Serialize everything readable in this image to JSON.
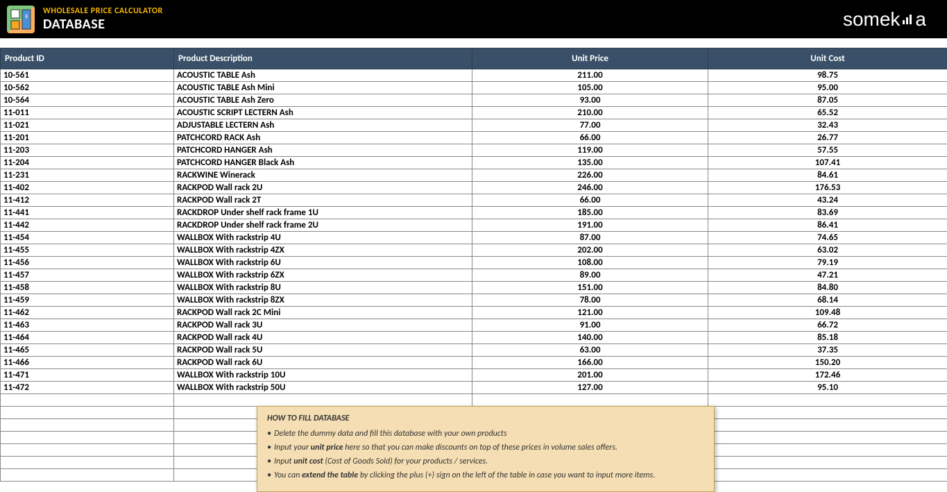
{
  "header": {
    "title1": "WHOLESALE PRICE CALCULATOR",
    "title2": "DATABASE",
    "brand": "someka"
  },
  "columns": {
    "product_id": "Product ID",
    "product_description": "Product Description",
    "unit_price": "Unit Price",
    "unit_cost": "Unit Cost"
  },
  "rows": [
    {
      "id": "10-561",
      "desc": "ACOUSTIC TABLE Ash",
      "price": "211.00",
      "cost": "98.75"
    },
    {
      "id": "10-562",
      "desc": "ACOUSTIC TABLE Ash Mini",
      "price": "105.00",
      "cost": "95.00"
    },
    {
      "id": "10-564",
      "desc": "ACOUSTIC TABLE Ash Zero",
      "price": "93.00",
      "cost": "87.05"
    },
    {
      "id": "11-011",
      "desc": "ACOUSTIC SCRIPT LECTERN Ash",
      "price": "210.00",
      "cost": "65.52"
    },
    {
      "id": "11-021",
      "desc": "ADJUSTABLE LECTERN Ash",
      "price": "77.00",
      "cost": "32.43"
    },
    {
      "id": "11-201",
      "desc": "PATCHCORD RACK Ash",
      "price": "66.00",
      "cost": "26.77"
    },
    {
      "id": "11-203",
      "desc": "PATCHCORD HANGER Ash",
      "price": "119.00",
      "cost": "57.55"
    },
    {
      "id": "11-204",
      "desc": "PATCHCORD HANGER Black Ash",
      "price": "135.00",
      "cost": "107.41"
    },
    {
      "id": "11-231",
      "desc": "RACKWINE Winerack",
      "price": "226.00",
      "cost": "84.61"
    },
    {
      "id": "11-402",
      "desc": "RACKPOD Wall rack 2U",
      "price": "246.00",
      "cost": "176.53"
    },
    {
      "id": "11-412",
      "desc": "RACKPOD Wall rack 2T",
      "price": "66.00",
      "cost": "43.24"
    },
    {
      "id": "11-441",
      "desc": "RACKDROP Under shelf rack frame 1U",
      "price": "185.00",
      "cost": "83.69"
    },
    {
      "id": "11-442",
      "desc": "RACKDROP Under shelf rack frame 2U",
      "price": "191.00",
      "cost": "86.41"
    },
    {
      "id": "11-454",
      "desc": "WALLBOX With rackstrip 4U",
      "price": "87.00",
      "cost": "74.65"
    },
    {
      "id": "11-455",
      "desc": "WALLBOX With rackstrip 4ZX",
      "price": "202.00",
      "cost": "63.02"
    },
    {
      "id": "11-456",
      "desc": "WALLBOX With rackstrip 6U",
      "price": "108.00",
      "cost": "79.19"
    },
    {
      "id": "11-457",
      "desc": "WALLBOX With rackstrip 6ZX",
      "price": "89.00",
      "cost": "47.21"
    },
    {
      "id": "11-458",
      "desc": "WALLBOX With rackstrip 8U",
      "price": "151.00",
      "cost": "84.80"
    },
    {
      "id": "11-459",
      "desc": "WALLBOX With rackstrip 8ZX",
      "price": "78.00",
      "cost": "68.14"
    },
    {
      "id": "11-462",
      "desc": "RACKPOD Wall rack 2C Mini",
      "price": "121.00",
      "cost": "109.48"
    },
    {
      "id": "11-463",
      "desc": "RACKPOD Wall rack 3U",
      "price": "91.00",
      "cost": "66.72"
    },
    {
      "id": "11-464",
      "desc": "RACKPOD Wall rack 4U",
      "price": "140.00",
      "cost": "85.18"
    },
    {
      "id": "11-465",
      "desc": "RACKPOD Wall rack 5U",
      "price": "63.00",
      "cost": "37.35"
    },
    {
      "id": "11-466",
      "desc": "RACKPOD Wall rack 6U",
      "price": "166.00",
      "cost": "150.20"
    },
    {
      "id": "11-471",
      "desc": "WALLBOX With rackstrip 10U",
      "price": "201.00",
      "cost": "172.46"
    },
    {
      "id": "11-472",
      "desc": "WALLBOX With rackstrip 50U",
      "price": "127.00",
      "cost": "95.10"
    }
  ],
  "empty_rows": 7,
  "hint": {
    "title": "HOW TO FILL DATABASE",
    "line1a": "Delete the dummy data and fill this database with your own products",
    "line2a": "Input your ",
    "line2b": "unit price",
    "line2c": " here so that you can make discounts on top of these prices in volume sales offers.",
    "line3a": "Input ",
    "line3b": "unit cost",
    "line3c": " (Cost of Goods Sold) for your products / services.",
    "line4a": "You can ",
    "line4b": "extend the table",
    "line4c": " by clicking the plus (+) sign on the left of the table in case you want to input more items."
  }
}
